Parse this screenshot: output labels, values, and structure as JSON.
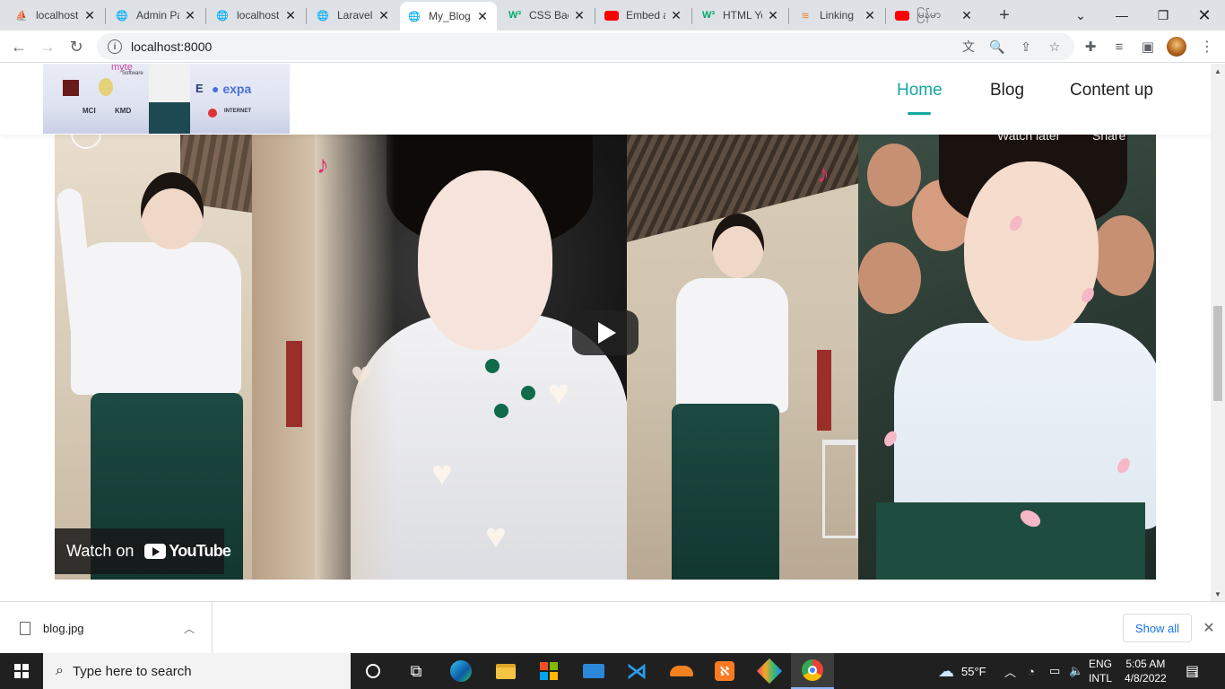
{
  "browser": {
    "tabs": [
      {
        "title": "localhost",
        "favicon": "phpmyadmin-icon",
        "fav_color": "#f89c0e"
      },
      {
        "title": "Admin Panel",
        "favicon": "globe-icon",
        "fav_color": "#5f6368"
      },
      {
        "title": "localhost",
        "favicon": "globe-icon",
        "fav_color": "#5f6368"
      },
      {
        "title": "Laravel",
        "favicon": "globe-icon",
        "fav_color": "#5f6368"
      },
      {
        "title": "My_Blog",
        "favicon": "globe-icon",
        "fav_color": "#5f6368",
        "active": true
      },
      {
        "title": "CSS Background",
        "favicon": "w3schools-icon",
        "fav_color": "#04aa6d"
      },
      {
        "title": "Embed a YouTube",
        "favicon": "youtube-icon",
        "fav_color": "#ff0000"
      },
      {
        "title": "HTML YouTube",
        "favicon": "w3schools-icon",
        "fav_color": "#04aa6d"
      },
      {
        "title": "Linking",
        "favicon": "stackoverflow-icon",
        "fav_color": "#f48024"
      },
      {
        "title": "မြန်မာ",
        "favicon": "youtube-icon",
        "fav_color": "#ff0000"
      }
    ],
    "url": "localhost:8000"
  },
  "site": {
    "nav": [
      {
        "label": "Home",
        "active": true
      },
      {
        "label": "Blog"
      },
      {
        "label": "Content up"
      }
    ],
    "logo": {
      "expa": "expa",
      "myte": "myte",
      "software": "Software",
      "kmd": "KMD",
      "internet": "INTERNET",
      "mci": "MCI"
    }
  },
  "video": {
    "watch_later": "Watch later",
    "share": "Share",
    "watch_on": "Watch on",
    "youtube": "YouTube"
  },
  "downloads": {
    "file": "blog.jpg",
    "show_all": "Show all"
  },
  "taskbar": {
    "search_placeholder": "Type here to search",
    "weather": "55°F",
    "lang_top": "ENG",
    "lang_bottom": "INTL",
    "time": "5:05 AM",
    "date": "4/8/2022",
    "notif_count": "1"
  }
}
